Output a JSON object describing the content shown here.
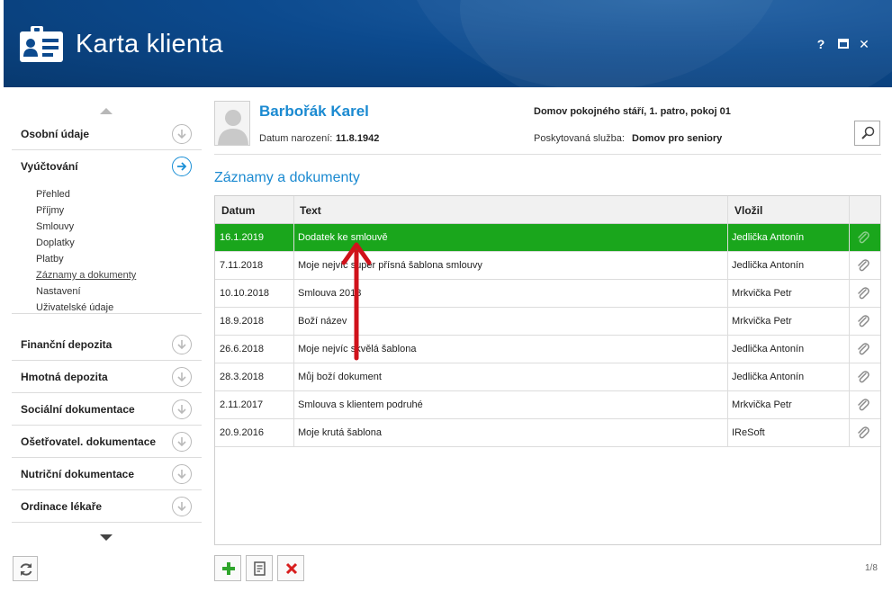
{
  "window": {
    "title": "Karta klienta",
    "controls": {
      "help": "?",
      "close": "✕"
    }
  },
  "sidebar": {
    "items": [
      {
        "label": "Osobní údaje"
      },
      {
        "label": "Vyúčtování",
        "subitems": [
          "Přehled",
          "Příjmy",
          "Smlouvy",
          "Doplatky",
          "Platby",
          "Záznamy a dokumenty",
          "Nastavení",
          "Uživatelské údaje"
        ]
      },
      {
        "label": "Finanční depozita"
      },
      {
        "label": "Hmotná depozita"
      },
      {
        "label": "Sociální dokumentace"
      },
      {
        "label": "Ošetřovatel. dokumentace"
      },
      {
        "label": "Nutriční dokumentace"
      },
      {
        "label": "Ordinace lékaře"
      }
    ]
  },
  "client": {
    "name": "Barbořák Karel",
    "dob_label": "Datum narození:",
    "dob": "11.8.1942",
    "home": "Domov pokojného stáří, 1. patro, pokoj 01",
    "service_label": "Poskytovaná služba:",
    "service": "Domov pro seniory"
  },
  "section": {
    "title": "Záznamy a dokumenty"
  },
  "table": {
    "columns": [
      "Datum",
      "Text",
      "Vložil"
    ],
    "rows": [
      {
        "date": "16.1.2019",
        "text": "Dodatek ke smlouvě",
        "author": "Jedlička Antonín",
        "selected": true
      },
      {
        "date": "7.11.2018",
        "text": "Moje nejvíc super přísná šablona smlouvy",
        "author": "Jedlička Antonín"
      },
      {
        "date": "10.10.2018",
        "text": "Smlouva 2018",
        "author": "Mrkvička Petr"
      },
      {
        "date": "18.9.2018",
        "text": "Boží název",
        "author": "Mrkvička Petr"
      },
      {
        "date": "26.6.2018",
        "text": "Moje nejvíc skvělá šablona",
        "author": "Jedlička Antonín"
      },
      {
        "date": "28.3.2018",
        "text": "Můj boží dokument",
        "author": "Jedlička Antonín"
      },
      {
        "date": "2.11.2017",
        "text": "Smlouva s klientem podruhé",
        "author": "Mrkvička Petr"
      },
      {
        "date": "20.9.2016",
        "text": "Moje krutá šablona",
        "author": "IReSoft"
      }
    ]
  },
  "pager": {
    "text": "1/8"
  },
  "colors": {
    "accent": "#1b8ad1",
    "selected_row": "#1aa61c",
    "titlebar": "#0c4a8e",
    "annotation": "#d0121b"
  }
}
